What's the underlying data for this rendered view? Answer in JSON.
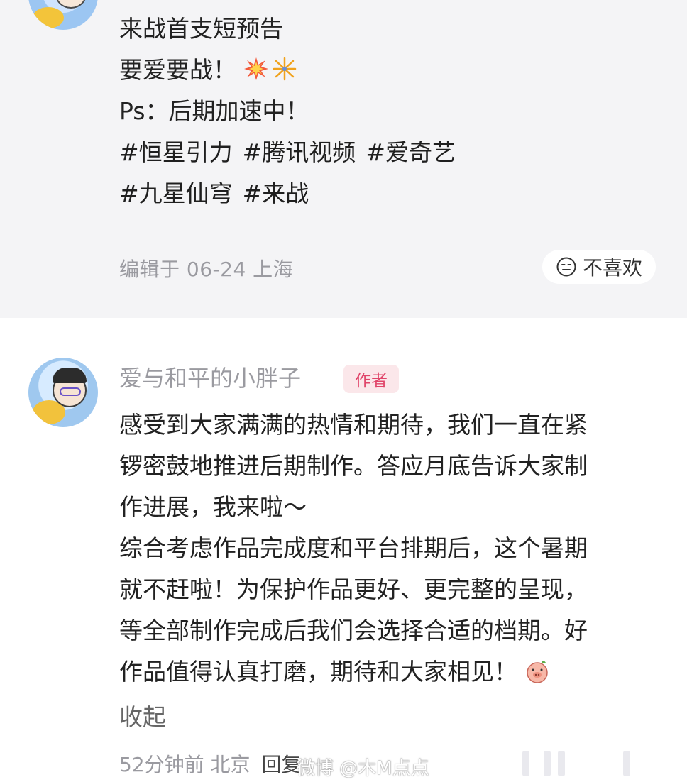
{
  "post": {
    "lines": [
      "来战首支短预告",
      "要爱要战！",
      "Ps：后期加速中！"
    ],
    "hashtags_line1": [
      "#恒星引力",
      "#腾讯视频",
      "#爱奇艺"
    ],
    "hashtags_line2": [
      "#九星仙穹",
      "#来战"
    ],
    "meta": "编辑于 06-24 上海",
    "dislike_label": "不喜欢"
  },
  "reply": {
    "author": "爱与和平的小胖子",
    "badge": "作者",
    "lines": [
      "感受到大家满满的热情和期待，我们一直在紧",
      "锣密鼓地推进后期制作。答应月底告诉大家制",
      "作进展，我来啦～",
      "综合考虑作品完成度和平台排期后，这个暑期",
      "就不赶啦！为保护作品更好、更完整的呈现，",
      "等全部制作完成后我们会选择合适的档期。好",
      "作品值得认真打磨，期待和大家相见！"
    ],
    "collapse_label": "收起",
    "meta": "52分钟前 北京",
    "reply_label": "回复"
  },
  "watermark": "微博 @木M点点",
  "colors": {
    "post_bg": "#f4f4f6",
    "badge_bg": "#fbe7ea",
    "badge_text": "#e0456a",
    "meta_text": "#9a9aa0"
  }
}
